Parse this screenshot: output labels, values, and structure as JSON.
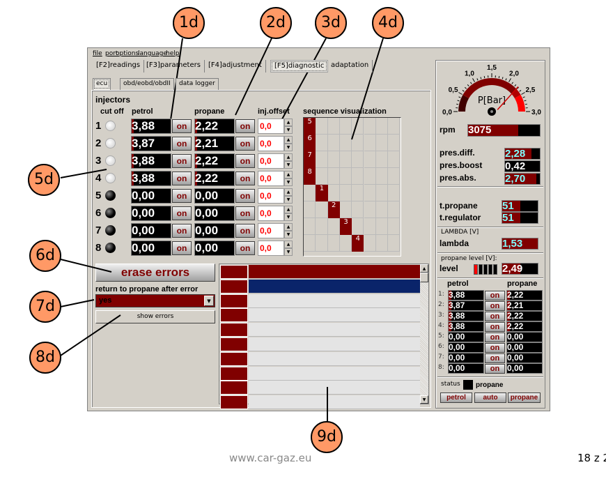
{
  "menu": [
    "file",
    "port",
    "options",
    "language",
    "help"
  ],
  "tabs": [
    "[F2]readings",
    "[F3]parameters",
    "[F4]adjustment",
    "[F5]diagnostic",
    "adaptation"
  ],
  "selected_tab": "[F5]diagnostic",
  "subtabs": [
    "ecu",
    "obd/eobd/obdII",
    "data logger"
  ],
  "selected_subtab": "ecu",
  "injectors": {
    "title": "injectors",
    "headers": {
      "cutoff": "cut off",
      "petrol": "petrol",
      "propane": "propane",
      "offset": "inj.offset",
      "sequence": "sequence visualization"
    },
    "on_label": "on",
    "rows": [
      {
        "n": "1",
        "cut_off": false,
        "petrol": "3,88",
        "propane": "2,22",
        "offset": "0,0"
      },
      {
        "n": "2",
        "cut_off": false,
        "petrol": "3,87",
        "propane": "2,21",
        "offset": "0,0"
      },
      {
        "n": "3",
        "cut_off": false,
        "petrol": "3,88",
        "propane": "2,22",
        "offset": "0,0"
      },
      {
        "n": "4",
        "cut_off": false,
        "petrol": "3,88",
        "propane": "2,22",
        "offset": "0,0"
      },
      {
        "n": "5",
        "cut_off": true,
        "petrol": "0,00",
        "propane": "0,00",
        "offset": "0,0"
      },
      {
        "n": "6",
        "cut_off": true,
        "petrol": "0,00",
        "propane": "0,00",
        "offset": "0,0"
      },
      {
        "n": "7",
        "cut_off": true,
        "petrol": "0,00",
        "propane": "0,00",
        "offset": "0,0"
      },
      {
        "n": "8",
        "cut_off": true,
        "petrol": "0,00",
        "propane": "0,00",
        "offset": "0,0"
      }
    ],
    "sequence": [
      {
        "label": "5",
        "col": 0,
        "row": 0
      },
      {
        "label": "6",
        "col": 0,
        "row": 1
      },
      {
        "label": "7",
        "col": 0,
        "row": 2
      },
      {
        "label": "8",
        "col": 0,
        "row": 3
      },
      {
        "label": "1",
        "col": 1,
        "row": 4
      },
      {
        "label": "2",
        "col": 2,
        "row": 5
      },
      {
        "label": "3",
        "col": 3,
        "row": 6
      },
      {
        "label": "4",
        "col": 4,
        "row": 7
      }
    ]
  },
  "errors": {
    "erase_label": "erase errors",
    "return_label": "return to propane after error",
    "return_value": "yes",
    "show_label": "show errors",
    "row_count": 10
  },
  "gauge": {
    "unit": "P[Bar]",
    "ticks": [
      "0,0",
      "0,5",
      "1,0",
      "1,5",
      "2,0",
      "2,5",
      "3,0"
    ],
    "min": 0,
    "max": 3,
    "value": 2.28
  },
  "readings": {
    "rpm": {
      "label": "rpm",
      "value": "3075",
      "fill": 0.7
    },
    "pres_diff": {
      "label": "pres.diff.",
      "value": "2,28",
      "fill": 0.76
    },
    "pres_boost": {
      "label": "pres.boost",
      "value": "0,42",
      "fill": 0
    },
    "pres_abs": {
      "label": "pres.abs.",
      "value": "2,70",
      "fill": 0.9
    },
    "t_propane": {
      "label": "t.propane",
      "value": "51",
      "fill": 0.5
    },
    "t_regulator": {
      "label": "t.regulator",
      "value": "51",
      "fill": 0.5
    },
    "lambda_title": "LAMBDA [V]",
    "lambda": {
      "label": "lambda",
      "value": "1,53",
      "fill": 1
    },
    "level_title": "propane level [V]:",
    "level": {
      "label": "level",
      "value": "2,49",
      "fill": 0.5,
      "bars_lit": 1,
      "bars_total": 5
    }
  },
  "mini": {
    "petrol_header": "petrol",
    "propane_header": "propane",
    "on_label": "on",
    "rows": [
      {
        "n": "1:",
        "petrol": "3,88",
        "propane": "2,22"
      },
      {
        "n": "2:",
        "petrol": "3,87",
        "propane": "2,21"
      },
      {
        "n": "3:",
        "petrol": "3,88",
        "propane": "2,22"
      },
      {
        "n": "4:",
        "petrol": "3,88",
        "propane": "2,22"
      },
      {
        "n": "5:",
        "petrol": "0,00",
        "propane": "0,00"
      },
      {
        "n": "6:",
        "petrol": "0,00",
        "propane": "0,00"
      },
      {
        "n": "7:",
        "petrol": "0,00",
        "propane": "0,00"
      },
      {
        "n": "8:",
        "petrol": "0,00",
        "propane": "0,00"
      }
    ]
  },
  "status": {
    "label": "status",
    "value": "propane",
    "buttons": [
      "petrol",
      "auto",
      "propane"
    ]
  },
  "callouts": [
    "1d",
    "2d",
    "3d",
    "4d",
    "5d",
    "6d",
    "7d",
    "8d",
    "9d"
  ],
  "footer": {
    "url": "www.car-gaz.eu",
    "page": "18 z 2"
  },
  "colors": {
    "dark_red": "#800000",
    "selected_row": "#0a246a",
    "callout": "#ff9966",
    "value_cyan": "#80ffff"
  }
}
